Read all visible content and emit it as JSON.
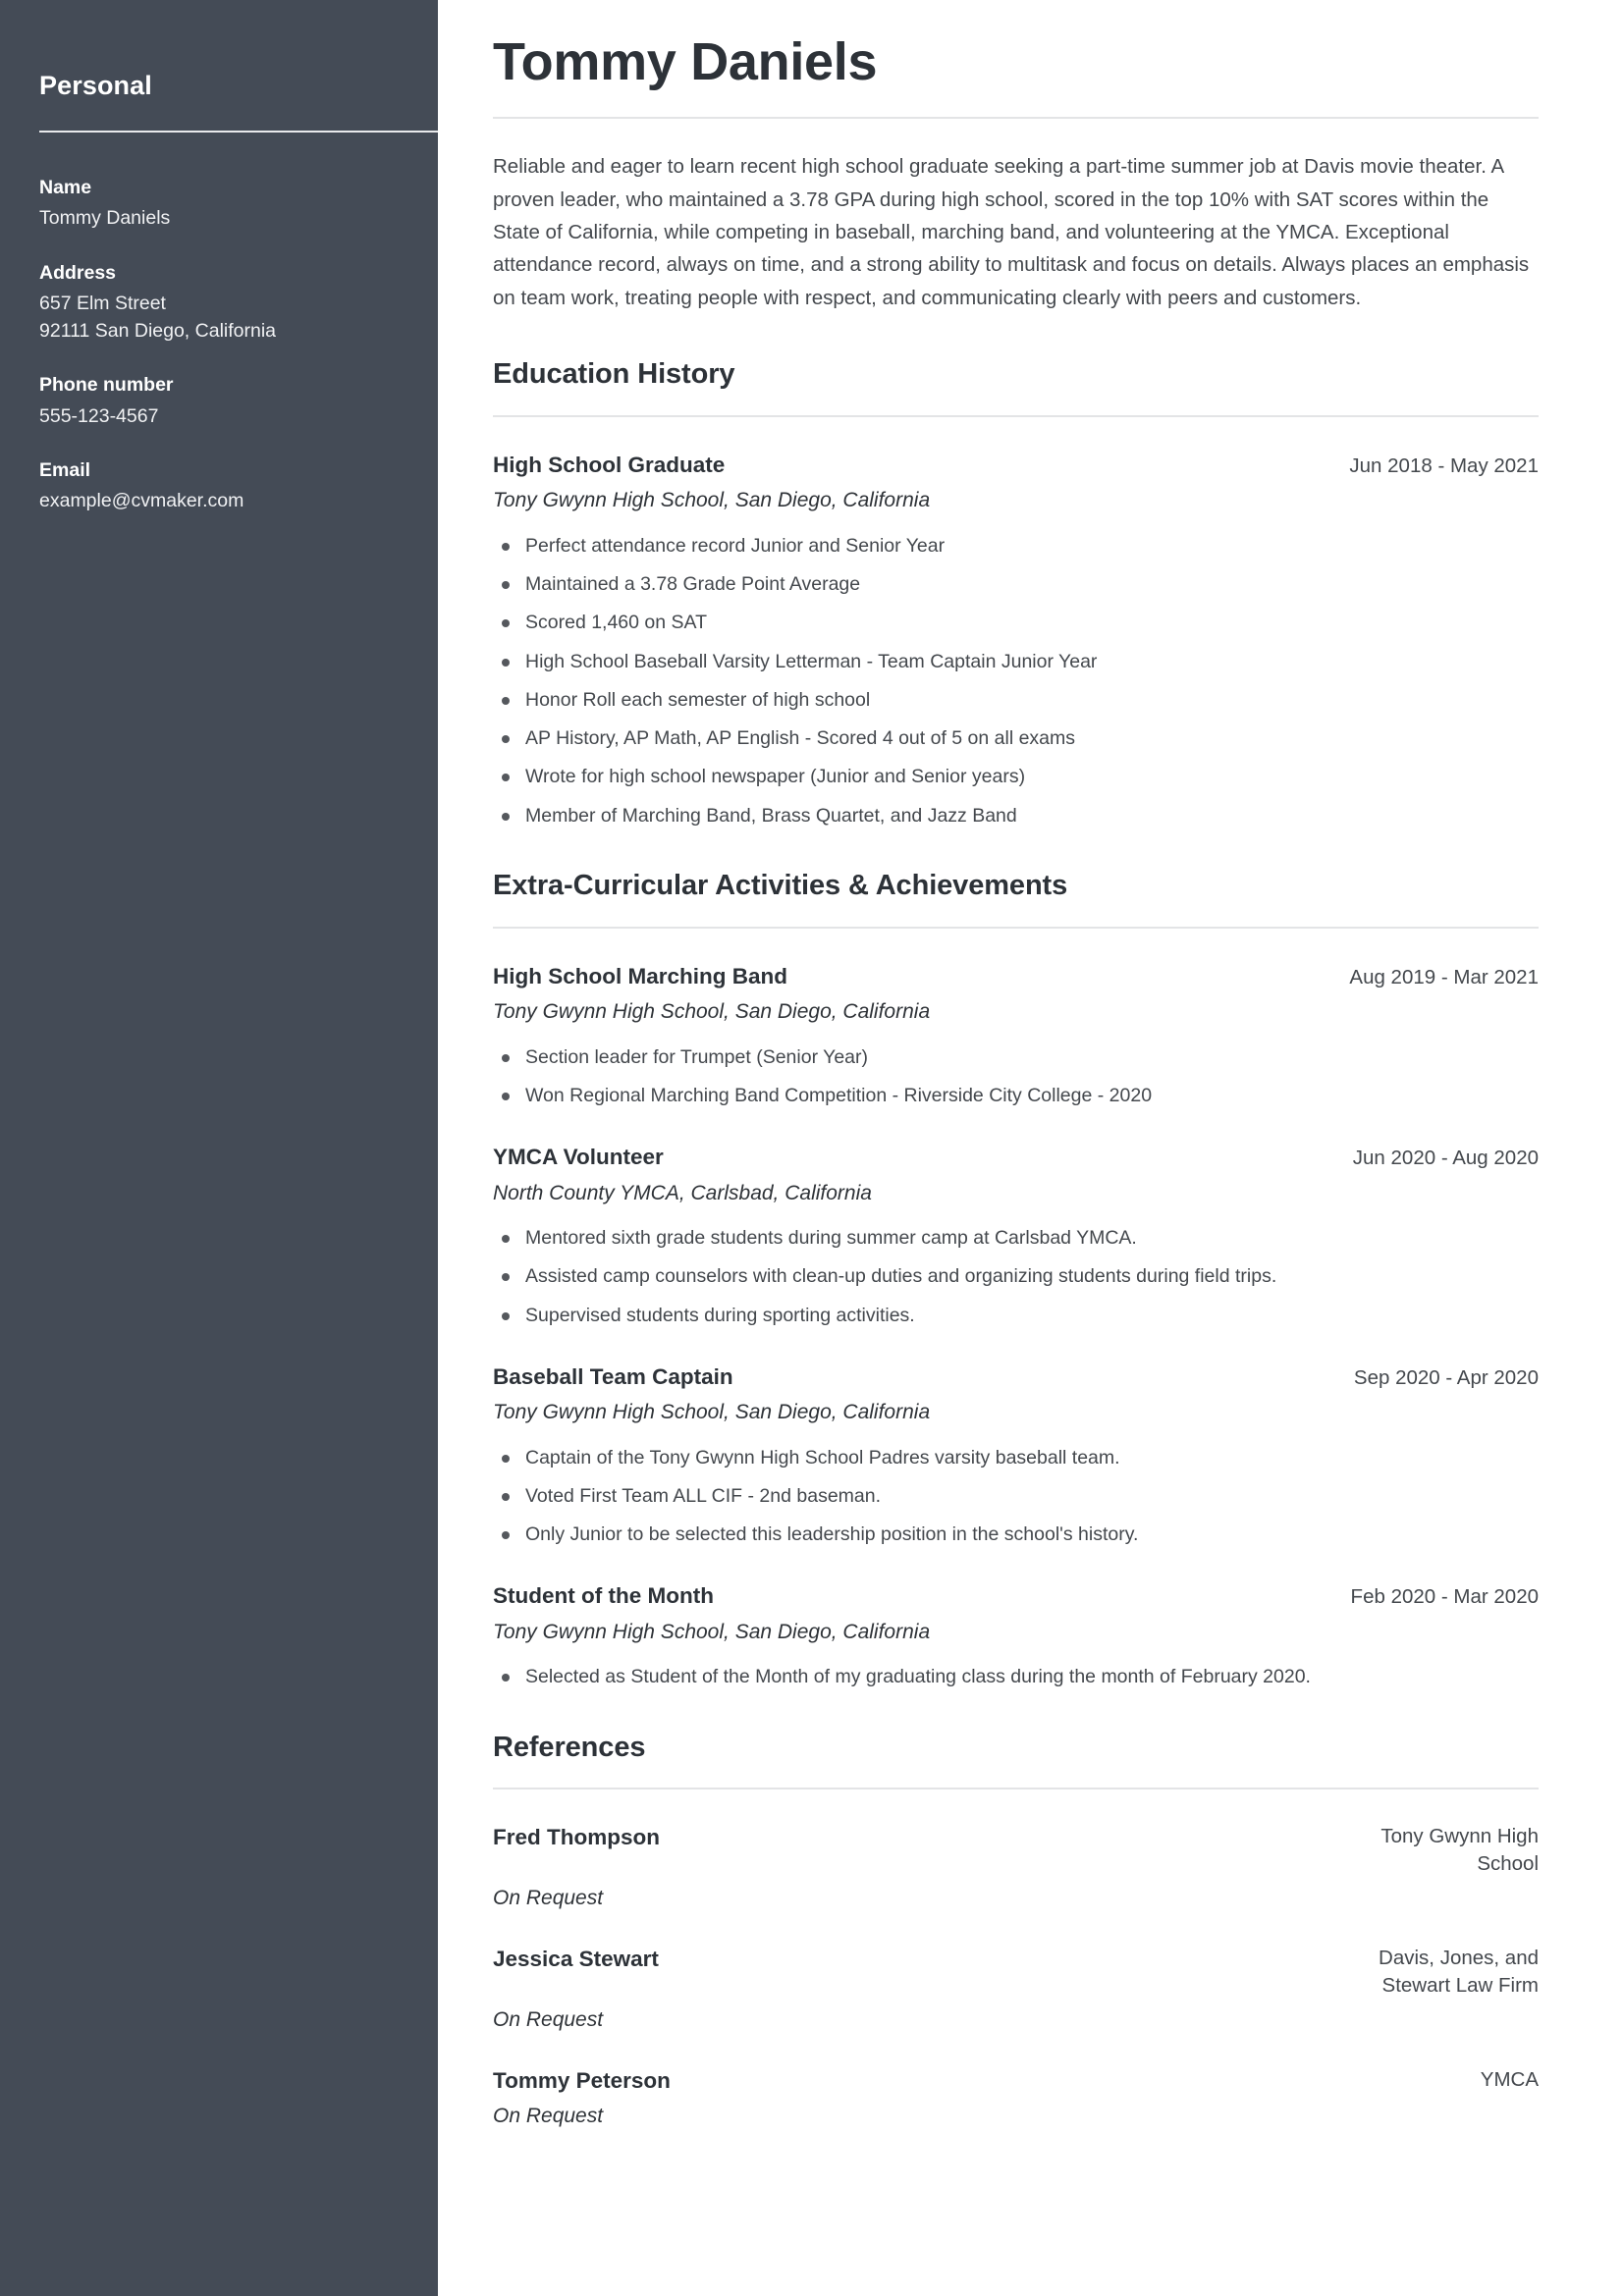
{
  "sidebar": {
    "title": "Personal",
    "fields": [
      {
        "label": "Name",
        "lines": [
          "Tommy Daniels"
        ]
      },
      {
        "label": "Address",
        "lines": [
          "657 Elm Street",
          "92111 San Diego, California"
        ]
      },
      {
        "label": "Phone number",
        "lines": [
          "555-123-4567"
        ]
      },
      {
        "label": "Email",
        "lines": [
          "example@cvmaker.com"
        ]
      }
    ]
  },
  "header": {
    "name": "Tommy Daniels"
  },
  "summary": {
    "text": "Reliable and eager to learn recent high school graduate seeking a part-time summer job at Davis movie theater. A proven leader, who maintained a 3.78 GPA during high school, scored in the top 10% with SAT scores within the State of California, while competing in baseball, marching band, and volunteering at the YMCA. Exceptional attendance record, always on time, and a strong ability to multitask and focus on details. Always places an emphasis on team work, treating people with respect, and communicating clearly with peers and customers."
  },
  "sections": [
    {
      "heading": "Education History",
      "entries": [
        {
          "title": "High School Graduate",
          "date": "Jun 2018 - May 2021",
          "subtitle": "Tony Gwynn High School, San Diego, California",
          "bullets": [
            "Perfect attendance record Junior and Senior Year",
            "Maintained a 3.78 Grade Point Average",
            "Scored 1,460 on SAT",
            "High School Baseball Varsity Letterman - Team Captain Junior Year",
            "Honor Roll each semester of high school",
            "AP History, AP Math, AP English - Scored 4 out of 5 on all exams",
            "Wrote for high school newspaper (Junior and Senior years)",
            "Member of Marching Band, Brass Quartet, and Jazz Band"
          ]
        }
      ]
    },
    {
      "heading": "Extra-Curricular Activities & Achievements",
      "entries": [
        {
          "title": "High School Marching Band",
          "date": "Aug 2019 - Mar 2021",
          "subtitle": "Tony Gwynn High School, San Diego, California",
          "bullets": [
            "Section leader for Trumpet (Senior Year)",
            "Won Regional Marching Band Competition - Riverside City College - 2020"
          ]
        },
        {
          "title": "YMCA Volunteer",
          "date": "Jun 2020 - Aug 2020",
          "subtitle": "North County YMCA, Carlsbad, California",
          "bullets": [
            "Mentored sixth grade students during summer camp at Carlsbad YMCA.",
            "Assisted camp counselors with clean-up duties and organizing students during field trips.",
            "Supervised students during sporting activities."
          ]
        },
        {
          "title": "Baseball Team Captain",
          "date": "Sep 2020 - Apr 2020",
          "subtitle": "Tony Gwynn High School, San Diego, California",
          "bullets": [
            "Captain of the Tony Gwynn High School Padres varsity baseball team.",
            "Voted First Team ALL CIF - 2nd baseman.",
            "Only Junior to be selected this leadership position in the school's history."
          ]
        },
        {
          "title": "Student of the Month",
          "date": "Feb 2020 - Mar 2020",
          "subtitle": "Tony Gwynn High School, San Diego, California",
          "bullets": [
            "Selected as Student of the Month of my graduating class during the month of February 2020."
          ]
        }
      ]
    }
  ],
  "references": {
    "heading": "References",
    "items": [
      {
        "name": "Fred Thompson",
        "organization": "Tony Gwynn High School",
        "status": "On Request"
      },
      {
        "name": "Jessica Stewart",
        "organization": "Davis, Jones, and Stewart Law Firm",
        "status": "On Request"
      },
      {
        "name": "Tommy Peterson",
        "organization": "YMCA",
        "status": "On Request"
      }
    ]
  },
  "colors": {
    "sidebar_background": "#444b56",
    "heading_text": "#2d3238",
    "body_text": "#44484d",
    "rule": "#e3e4e6"
  }
}
